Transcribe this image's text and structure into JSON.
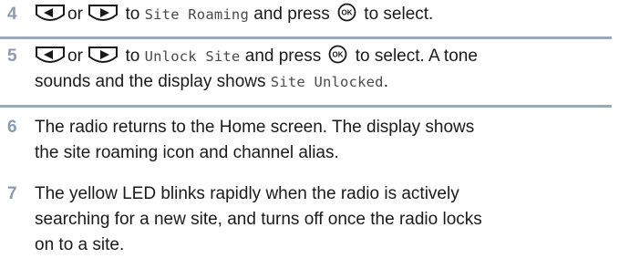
{
  "steps": [
    {
      "number": "4",
      "connector": "or",
      "to_text": "to",
      "menu_item": "Site Roaming",
      "press_text": "and press",
      "select_text": "to select."
    },
    {
      "number": "5",
      "connector": "or",
      "to_text": "to",
      "menu_item": "Unlock Site",
      "press_text": "and press",
      "select_text": "to select. A tone",
      "line2_text": "sounds and the display shows",
      "display_text": "Site Unlocked",
      "period": "."
    },
    {
      "number": "6",
      "line1": "The radio returns to the Home screen. The display shows",
      "line2": "the site roaming icon and channel alias."
    },
    {
      "number": "7",
      "line1": "The yellow LED blinks rapidly when the radio is actively",
      "line2": "searching for a new site, and turns off once the radio locks",
      "line3": "on to a site."
    }
  ],
  "icons": {
    "left_key": "left-arrow-key-icon",
    "right_key": "right-arrow-key-icon",
    "ok_button": "ok-button-icon"
  },
  "colors": {
    "step_number": "#8a9bb3",
    "divider": "#9aa8bf",
    "text": "#1a1a1a"
  }
}
